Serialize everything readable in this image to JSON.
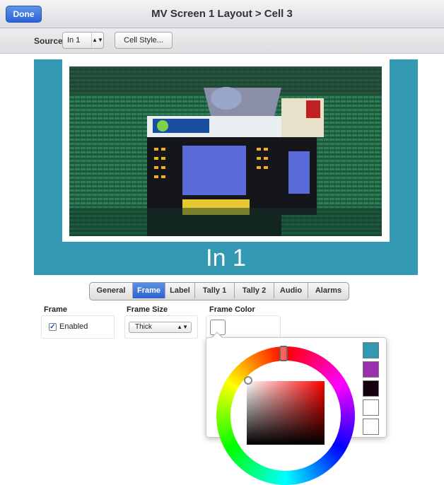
{
  "header": {
    "done_label": "Done",
    "title": "MV Screen 1 Layout > Cell 3"
  },
  "toolbar": {
    "source_label": "Source",
    "source_value": "In 1",
    "cell_style_label": "Cell Style..."
  },
  "preview": {
    "cell_label": "In 1",
    "background_color": "#3399b3",
    "video_description": "arena scoreboard video feed"
  },
  "tabs": [
    {
      "label": "General",
      "active": false
    },
    {
      "label": "Frame",
      "active": true
    },
    {
      "label": "Label",
      "active": false
    },
    {
      "label": "Tally 1",
      "active": false
    },
    {
      "label": "Tally 2",
      "active": false
    },
    {
      "label": "Audio",
      "active": false
    },
    {
      "label": "Alarms",
      "active": false
    }
  ],
  "frame_settings": {
    "frame_label": "Frame",
    "enabled_label": "Enabled",
    "enabled_checked": true,
    "size_label": "Frame Size",
    "size_value": "Thick",
    "color_label": "Frame Color",
    "color_value": "#ffffff"
  },
  "color_picker": {
    "selected_hue": "#ff0000",
    "presets": [
      "#3399b3",
      "#9b2fb0",
      "#14000f",
      "#ffffff",
      "#ffffff"
    ]
  }
}
